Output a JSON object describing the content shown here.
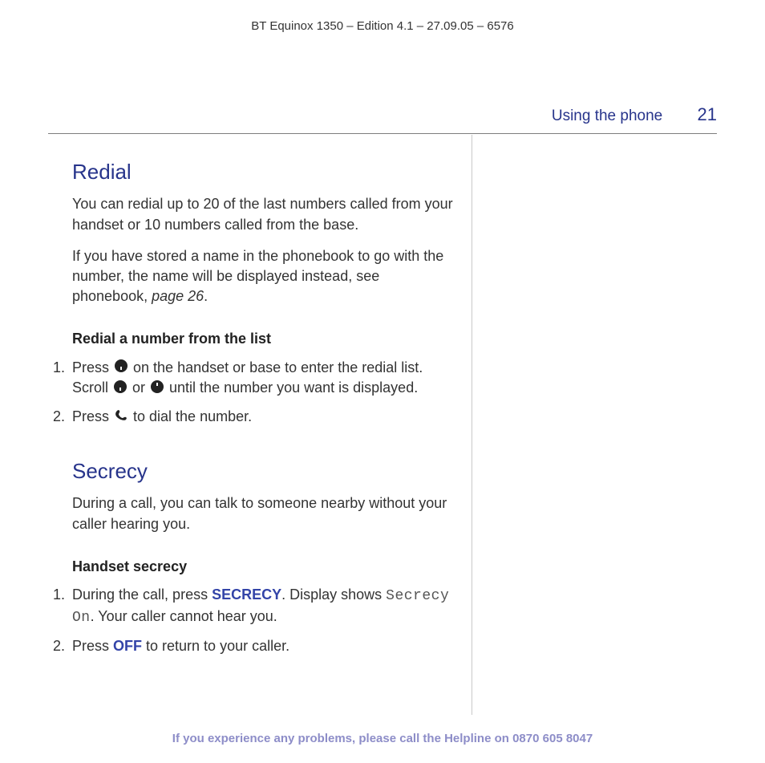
{
  "doc_header": "BT Equinox 1350 – Edition 4.1 – 27.09.05 – 6576",
  "section": {
    "name": "Using the phone",
    "page": "21"
  },
  "redial": {
    "title": "Redial",
    "intro_a": "You can redial up to 20 of the last numbers called from your handset or 10 numbers called from the base.",
    "intro_b_pre": "If you have stored a name in the phonebook to go with the number, the name will be displayed instead, see phonebook, ",
    "intro_b_ref": "page 26",
    "intro_b_post": ".",
    "sub": "Redial a number from the list",
    "step1_a": "Press ",
    "step1_b": " on the handset or base to enter the redial list. Scroll ",
    "step1_c": " or ",
    "step1_d": " until the number you want is displayed.",
    "step2_a": "Press ",
    "step2_b": " to dial the number."
  },
  "secrecy": {
    "title": "Secrecy",
    "intro": "During a call, you can talk to someone nearby without your caller hearing you.",
    "sub": "Handset secrecy",
    "step1_a": "During the call, press ",
    "step1_key": "SECRECY",
    "step1_b": ". Display shows ",
    "step1_lcd": "Secrecy On",
    "step1_c": ". Your caller cannot hear you.",
    "step2_a": "Press ",
    "step2_key": "OFF",
    "step2_b": " to return to your caller."
  },
  "footer": {
    "text": "If you experience any problems, please call the Helpline on ",
    "phone": "0870 605 8047"
  }
}
